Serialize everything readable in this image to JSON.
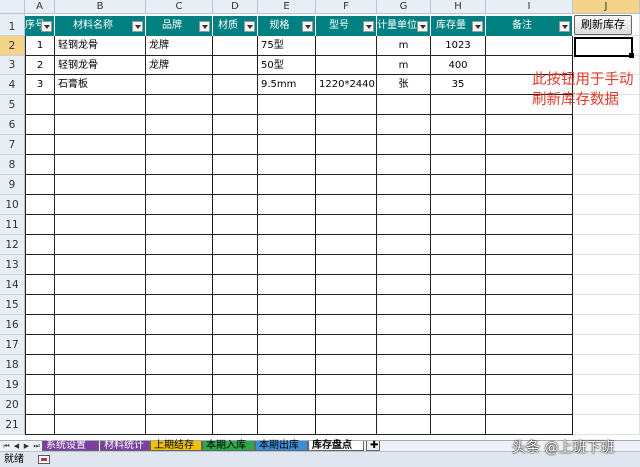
{
  "columns": [
    "A",
    "B",
    "C",
    "D",
    "E",
    "F",
    "G",
    "H",
    "I",
    "J"
  ],
  "rows": [
    "1",
    "2",
    "3",
    "4",
    "5",
    "6",
    "7",
    "8",
    "9",
    "10",
    "11",
    "12",
    "13",
    "14",
    "15",
    "16",
    "17",
    "18",
    "19",
    "20",
    "21"
  ],
  "headers": [
    "序号",
    "材料名称",
    "品牌",
    "材质",
    "规格",
    "型号",
    "计量单位",
    "库存量",
    "备注"
  ],
  "data": [
    [
      "1",
      "轻钢龙骨",
      "龙牌",
      "",
      "75型",
      "",
      "m",
      "1023",
      ""
    ],
    [
      "2",
      "轻钢龙骨",
      "龙牌",
      "",
      "50型",
      "",
      "m",
      "400",
      ""
    ],
    [
      "3",
      "石膏板",
      "",
      "",
      "9.5mm",
      "1220*2440",
      "张",
      "35",
      ""
    ]
  ],
  "button": {
    "label": "刷新库存"
  },
  "note": "此按钮用于手动刷新库存数据",
  "sheet_tabs": [
    {
      "label": "系统设置",
      "color": "#7a3fa0"
    },
    {
      "label": "材料统计",
      "color": "#7a3fa0"
    },
    {
      "label": "上期结存",
      "color": "#f2c200"
    },
    {
      "label": "本期入库",
      "color": "#2ca84a"
    },
    {
      "label": "本期出库",
      "color": "#3a8fd8"
    },
    {
      "label": "库存盘点",
      "color": "#ffffff",
      "active": true
    }
  ],
  "status": {
    "ready": "就绪"
  },
  "watermark": "头条 @上班下班",
  "colors": {
    "header_fill": "#008080",
    "note_text": "#e53b2a"
  }
}
